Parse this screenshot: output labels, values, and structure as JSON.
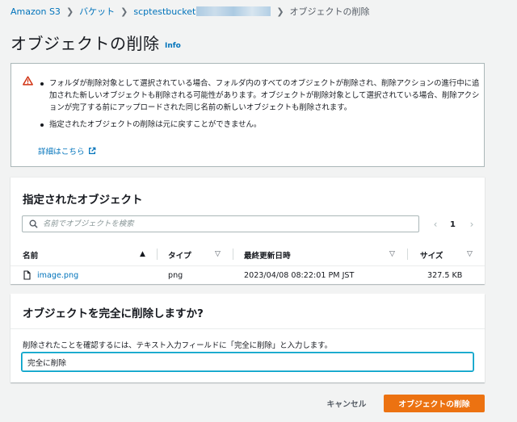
{
  "breadcrumb": {
    "items": [
      "Amazon S3",
      "バケット",
      "scptestbucket"
    ],
    "current": "オブジェクトの削除",
    "separator": "❯"
  },
  "header": {
    "title": "オブジェクトの削除",
    "info": "Info"
  },
  "alert": {
    "icon": "warning-icon",
    "bullets": [
      "フォルダが削除対象として選択されている場合、フォルダ内のすべてのオブジェクトが削除され、削除アクションの進行中に追加された新しいオブジェクトも削除される可能性があります。オブジェクトが削除対象として選択されている場合、削除アクションが完了する前にアップロードされた同じ名前の新しいオブジェクトも削除されます。",
      "指定されたオブジェクトの削除は元に戻すことができません。"
    ],
    "details_link": "詳細はこちら"
  },
  "objects": {
    "title": "指定されたオブジェクト",
    "search_placeholder": "名前でオブジェクトを検索",
    "page": "1",
    "columns": {
      "name": "名前",
      "type": "タイプ",
      "modified": "最終更新日時",
      "size": "サイズ"
    },
    "rows": [
      {
        "name": "image.png",
        "type": "png",
        "modified": "2023/04/08 08:22:01 PM JST",
        "size": "327.5 KB"
      }
    ]
  },
  "confirm": {
    "title": "オブジェクトを完全に削除しますか?",
    "instruction": "削除されたことを確認するには、テキスト入力フィールドに「完全に削除」と入力します。",
    "input_value": "完全に削除"
  },
  "footer": {
    "cancel": "キャンセル",
    "delete": "オブジェクトの削除"
  },
  "colors": {
    "accent": "#ec7211",
    "link": "#0073bb",
    "warning": "#d13212",
    "focus": "#00a1c9"
  }
}
